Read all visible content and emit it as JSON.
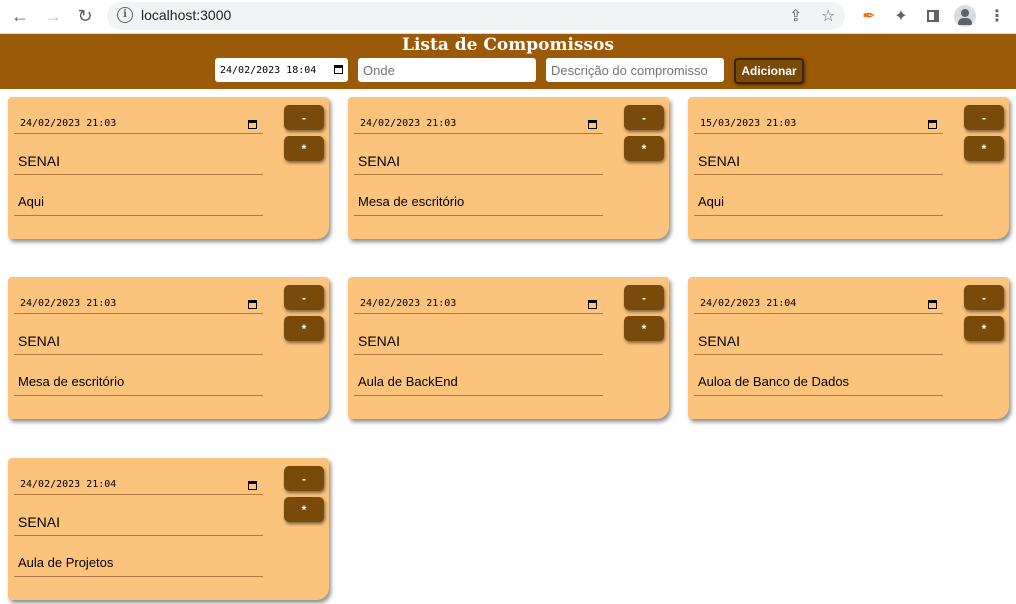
{
  "browser": {
    "url": "localhost:3000"
  },
  "app": {
    "title": "Lista de Compomissos",
    "new_date": "24/02/2023 18:04",
    "where_placeholder": "Onde",
    "desc_placeholder": "Descrição do compromisso",
    "add_label": "Adicionar"
  },
  "cards": [
    {
      "date": "24/02/2023 21:03",
      "where": "SENAI",
      "desc": "Aqui",
      "remove": "-",
      "edit": "*"
    },
    {
      "date": "24/02/2023 21:03",
      "where": "SENAI",
      "desc": "Mesa de escritório",
      "remove": "-",
      "edit": "*"
    },
    {
      "date": "15/03/2023 21:03",
      "where": "SENAI",
      "desc": "Aqui",
      "remove": "-",
      "edit": "*"
    },
    {
      "date": "24/02/2023 21:03",
      "where": "SENAI",
      "desc": "Mesa de escritório",
      "remove": "-",
      "edit": "*"
    },
    {
      "date": "24/02/2023 21:03",
      "where": "SENAI",
      "desc": "Aula de BackEnd",
      "remove": "-",
      "edit": "*"
    },
    {
      "date": "24/02/2023 21:04",
      "where": "SENAI",
      "desc": "Auloa de Banco de Dados",
      "remove": "-",
      "edit": "*"
    },
    {
      "date": "24/02/2023 21:04",
      "where": "SENAI",
      "desc": "Aula de Projetos",
      "remove": "-",
      "edit": "*"
    }
  ]
}
